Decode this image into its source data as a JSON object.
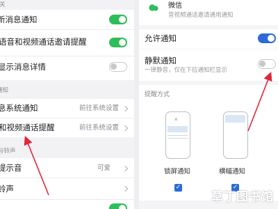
{
  "colors": {
    "toggle_green": "#2dbd59",
    "toggle_blue": "#2c6bd6",
    "toggle_off": "#c8c8c8",
    "arrow_red": "#e0273a",
    "section_bg": "#f2f2f4"
  },
  "left": {
    "header_partial": "关",
    "rows": [
      {
        "label": "新消息通知",
        "control": "toggle",
        "on": true
      },
      {
        "label": "语音和视频通话邀请提醒",
        "control": "toggle",
        "on": true
      },
      {
        "label": "显示消息详情",
        "control": "toggle",
        "on": false
      }
    ],
    "section_notice": "通知",
    "rows2": [
      {
        "label": "息系统通知",
        "hint": "前往系统设置",
        "control": "chevron"
      },
      {
        "label": "和视频通话提醒",
        "hint": "前往系统设置",
        "control": "chevron"
      }
    ],
    "section_ringtone": "与铃声",
    "rows3": [
      {
        "label": "提示音",
        "hint": "可爱",
        "control": "chevron"
      },
      {
        "label": "铃声",
        "hint": "",
        "control": "chevron"
      }
    ]
  },
  "right": {
    "app_name": "微信",
    "app_desc": "音视频通话邀请通用通知",
    "allow_label": "允许通知",
    "allow_on": true,
    "silent_label": "静默通知",
    "silent_desc": "一律静音，仅在下拉通知栏显示",
    "silent_on": false,
    "style_header": "提醒方式",
    "styles": [
      {
        "label": "锁屏通知",
        "checked": true
      },
      {
        "label": "横幅通知",
        "checked": true
      }
    ]
  },
  "watermark": "草丁图书馆"
}
